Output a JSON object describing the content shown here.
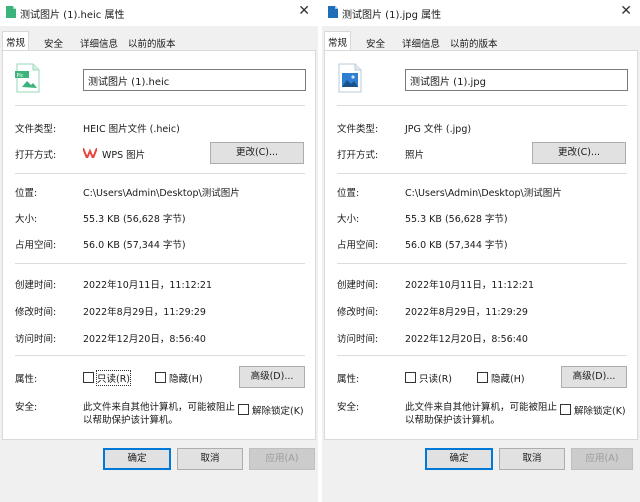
{
  "left": {
    "title": "测试图片 (1).heic 属性",
    "tabs": [
      "常规",
      "安全",
      "详细信息",
      "以前的版本"
    ],
    "filename": "测试图片 (1).heic",
    "labels": {
      "type": "文件类型:",
      "opens": "打开方式:",
      "location": "位置:",
      "size": "大小:",
      "disk": "占用空间:",
      "created": "创建时间:",
      "modified": "修改时间:",
      "accessed": "访问时间:",
      "attributes": "属性:",
      "security": "安全:"
    },
    "file_type": "HEIC 图片文件 (.heic)",
    "opens_with": "WPS 图片",
    "change_btn": "更改(C)...",
    "location": "C:\\Users\\Admin\\Desktop\\测试图片",
    "size": "55.3 KB (56,628 字节)",
    "disk_size": "56.0 KB (57,344 字节)",
    "created": "2022年10月11日，11:12:21",
    "modified": "2022年8月29日，11:29:29",
    "accessed": "2022年12月20日，8:56:40",
    "readonly": "只读(R)",
    "hidden": "隐藏(H)",
    "advanced_btn": "高级(D)...",
    "security_line1": "此文件来自其他计算机，可能被阻止",
    "security_line2": "以帮助保护该计算机。",
    "unblock": "解除锁定(K)",
    "ok": "确定",
    "cancel": "取消",
    "apply": "应用(A)"
  },
  "right": {
    "title": "测试图片 (1).jpg 属性",
    "tabs": [
      "常规",
      "安全",
      "详细信息",
      "以前的版本"
    ],
    "filename": "测试图片 (1).jpg",
    "labels": {
      "type": "文件类型:",
      "opens": "打开方式:",
      "location": "位置:",
      "size": "大小:",
      "disk": "占用空间:",
      "created": "创建时间:",
      "modified": "修改时间:",
      "accessed": "访问时间:",
      "attributes": "属性:",
      "security": "安全:"
    },
    "file_type": "JPG 文件 (.jpg)",
    "opens_with": "照片",
    "change_btn": "更改(C)...",
    "location": "C:\\Users\\Admin\\Desktop\\测试图片",
    "size": "55.3 KB (56,628 字节)",
    "disk_size": "56.0 KB (57,344 字节)",
    "created": "2022年10月11日，11:12:21",
    "modified": "2022年8月29日，11:29:29",
    "accessed": "2022年12月20日，8:56:40",
    "readonly": "只读(R)",
    "hidden": "隐藏(H)",
    "advanced_btn": "高级(D)...",
    "security_line1": "此文件来自其他计算机，可能被阻止",
    "security_line2": "以帮助保护该计算机。",
    "unblock": "解除锁定(K)",
    "ok": "确定",
    "cancel": "取消",
    "apply": "应用(A)"
  },
  "icons": {
    "heic_icon": "heic-file-icon",
    "jpg_icon": "jpg-file-icon",
    "wps_icon": "wps-image-icon",
    "close": "close-icon"
  },
  "colors": {
    "accent": "#0078d7",
    "window_bg": "#f0f0f0",
    "pane_bg": "#ffffff",
    "heic_green": "#3bb37b",
    "jpg_blue": "#1e6fb8",
    "wps_red": "#e8463b"
  }
}
